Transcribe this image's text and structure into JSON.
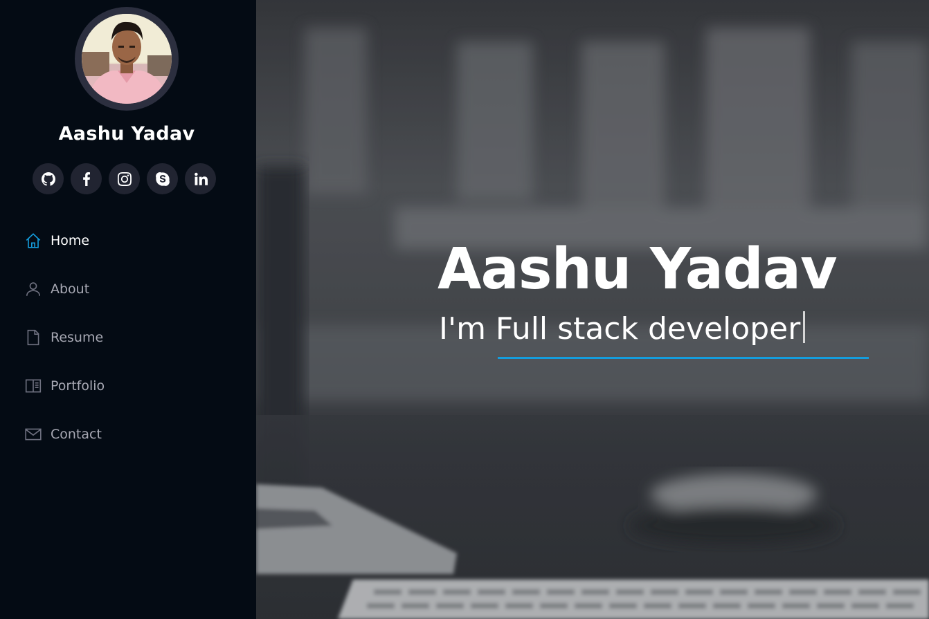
{
  "profile": {
    "name": "Aashu Yadav",
    "avatar_alt": "profile photo"
  },
  "social": [
    {
      "name": "github",
      "icon": "github-icon"
    },
    {
      "name": "facebook",
      "icon": "facebook-icon"
    },
    {
      "name": "instagram",
      "icon": "instagram-icon"
    },
    {
      "name": "skype",
      "icon": "skype-icon"
    },
    {
      "name": "linkedin",
      "icon": "linkedin-icon"
    }
  ],
  "nav": {
    "items": [
      {
        "label": "Home",
        "icon": "home-icon",
        "active": true
      },
      {
        "label": "About",
        "icon": "person-icon",
        "active": false
      },
      {
        "label": "Resume",
        "icon": "file-icon",
        "active": false
      },
      {
        "label": "Portfolio",
        "icon": "book-half-icon",
        "active": false
      },
      {
        "label": "Contact",
        "icon": "envelope-icon",
        "active": false
      }
    ]
  },
  "hero": {
    "title": "Aashu Yadav",
    "subtitle": "I'm Full stack developer"
  },
  "colors": {
    "accent": "#149ddd",
    "sidebar_bg": "#040b14",
    "social_bg": "#212431",
    "nav_text": "#a8a9b4"
  }
}
